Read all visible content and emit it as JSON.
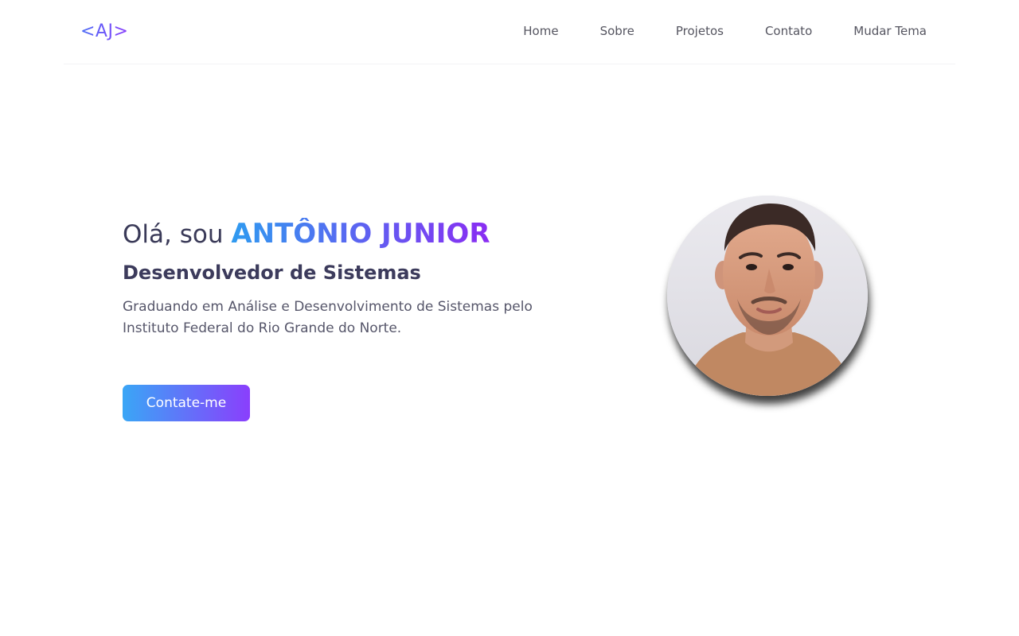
{
  "header": {
    "logo": "<AJ>",
    "nav": [
      "Home",
      "Sobre",
      "Projetos",
      "Contato",
      "Mudar Tema"
    ]
  },
  "hero": {
    "greeting_prefix": "Olá, sou",
    "name": "ANTÔNIO JUNIOR",
    "role": "Desenvolvedor de Sistemas",
    "description": "Graduando em Análise e Desenvolvimento de Sistemas pelo Instituto Federal do Rio Grande do Norte.",
    "cta_label": "Contate-me"
  },
  "colors": {
    "gradient_start": "#2f9bf0",
    "gradient_end": "#8a2cf2",
    "text_dark": "#3a3a58"
  }
}
